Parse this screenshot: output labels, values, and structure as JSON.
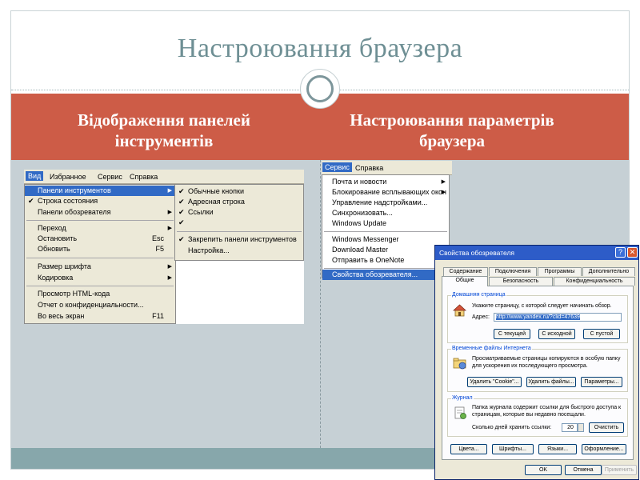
{
  "slide": {
    "title": "Настроювання браузера",
    "left_header": "Відображення панелей інструментів",
    "right_header": "Настроювання параметрів браузера"
  },
  "view_menu": {
    "menubar": [
      "Вид",
      "Избранное",
      "Сервис",
      "Справка"
    ],
    "items": [
      {
        "label": "Панели инструментов",
        "arrow": "▶",
        "highlighted": true
      },
      {
        "label": "Строка состояния",
        "check": "✔"
      },
      {
        "label": "Панели обозревателя",
        "arrow": "▶"
      },
      {
        "label": "Переход",
        "arrow": "▶"
      },
      {
        "label": "Остановить",
        "key": "Esc"
      },
      {
        "label": "Обновить",
        "key": "F5"
      },
      {
        "label": "Размер шрифта",
        "arrow": "▶"
      },
      {
        "label": "Кодировка",
        "arrow": "▶"
      },
      {
        "label": "Просмотр HTML-кода"
      },
      {
        "label": "Отчет о конфиденциальности..."
      },
      {
        "label": "Во весь экран",
        "key": "F11"
      }
    ],
    "submenu": [
      {
        "label": "Обычные кнопки",
        "check": "✔"
      },
      {
        "label": "Адресная строка",
        "check": "✔"
      },
      {
        "label": "Ссылки",
        "check": "✔"
      },
      {
        "label": "",
        "check": "✔"
      },
      {
        "label": "Закрепить панели инструментов",
        "check": "✔"
      },
      {
        "label": "Настройка..."
      }
    ]
  },
  "tools_menu": {
    "menubar": [
      "Сервис",
      "Справка"
    ],
    "items": [
      {
        "label": "Почта и новости",
        "arrow": "▶"
      },
      {
        "label": "Блокирование всплывающих окон",
        "arrow": "▶"
      },
      {
        "label": "Управление надстройками..."
      },
      {
        "label": "Синхронизовать..."
      },
      {
        "label": "Windows Update"
      },
      {
        "label": "Windows Messenger"
      },
      {
        "label": "Download Master"
      },
      {
        "label": "Отправить в OneNote"
      },
      {
        "label": "Свойства обозревателя...",
        "highlighted": true
      }
    ]
  },
  "dialog": {
    "title": "Свойства обозревателя",
    "help_glyph": "?",
    "close_glyph": "✕",
    "tabs_row1": [
      "Содержание",
      "Подключения",
      "Программы",
      "Дополнительно"
    ],
    "tabs_row2": [
      "Общие",
      "Безопасность",
      "Конфиденциальность"
    ],
    "home": {
      "group_title": "Домашняя страница",
      "text": "Укажите страницу, с которой следует начинать обзор.",
      "address_label": "Адрес:",
      "address_value": "http://www.yandex.ru/?clid=47639",
      "buttons": [
        "С текущей",
        "С исходной",
        "С пустой"
      ]
    },
    "temp": {
      "group_title": "Временные файлы Интернета",
      "text": "Просматриваемые страницы копируются в особую папку для ускорения их последующего просмотра.",
      "buttons": [
        "Удалить \"Cookie\"...",
        "Удалить файлы...",
        "Параметры..."
      ]
    },
    "history": {
      "group_title": "Журнал",
      "text": "Папка журнала содержит ссылки для быстрого доступа к страницам, которые вы недавно посещали.",
      "days_label": "Сколько дней хранить ссылки:",
      "days_value": "20",
      "clear_button": "Очистить"
    },
    "bottom_buttons": [
      "Цвета...",
      "Шрифты...",
      "Языки...",
      "Оформление..."
    ],
    "ok": "OK",
    "cancel": "Отмена",
    "apply": "Применить"
  }
}
